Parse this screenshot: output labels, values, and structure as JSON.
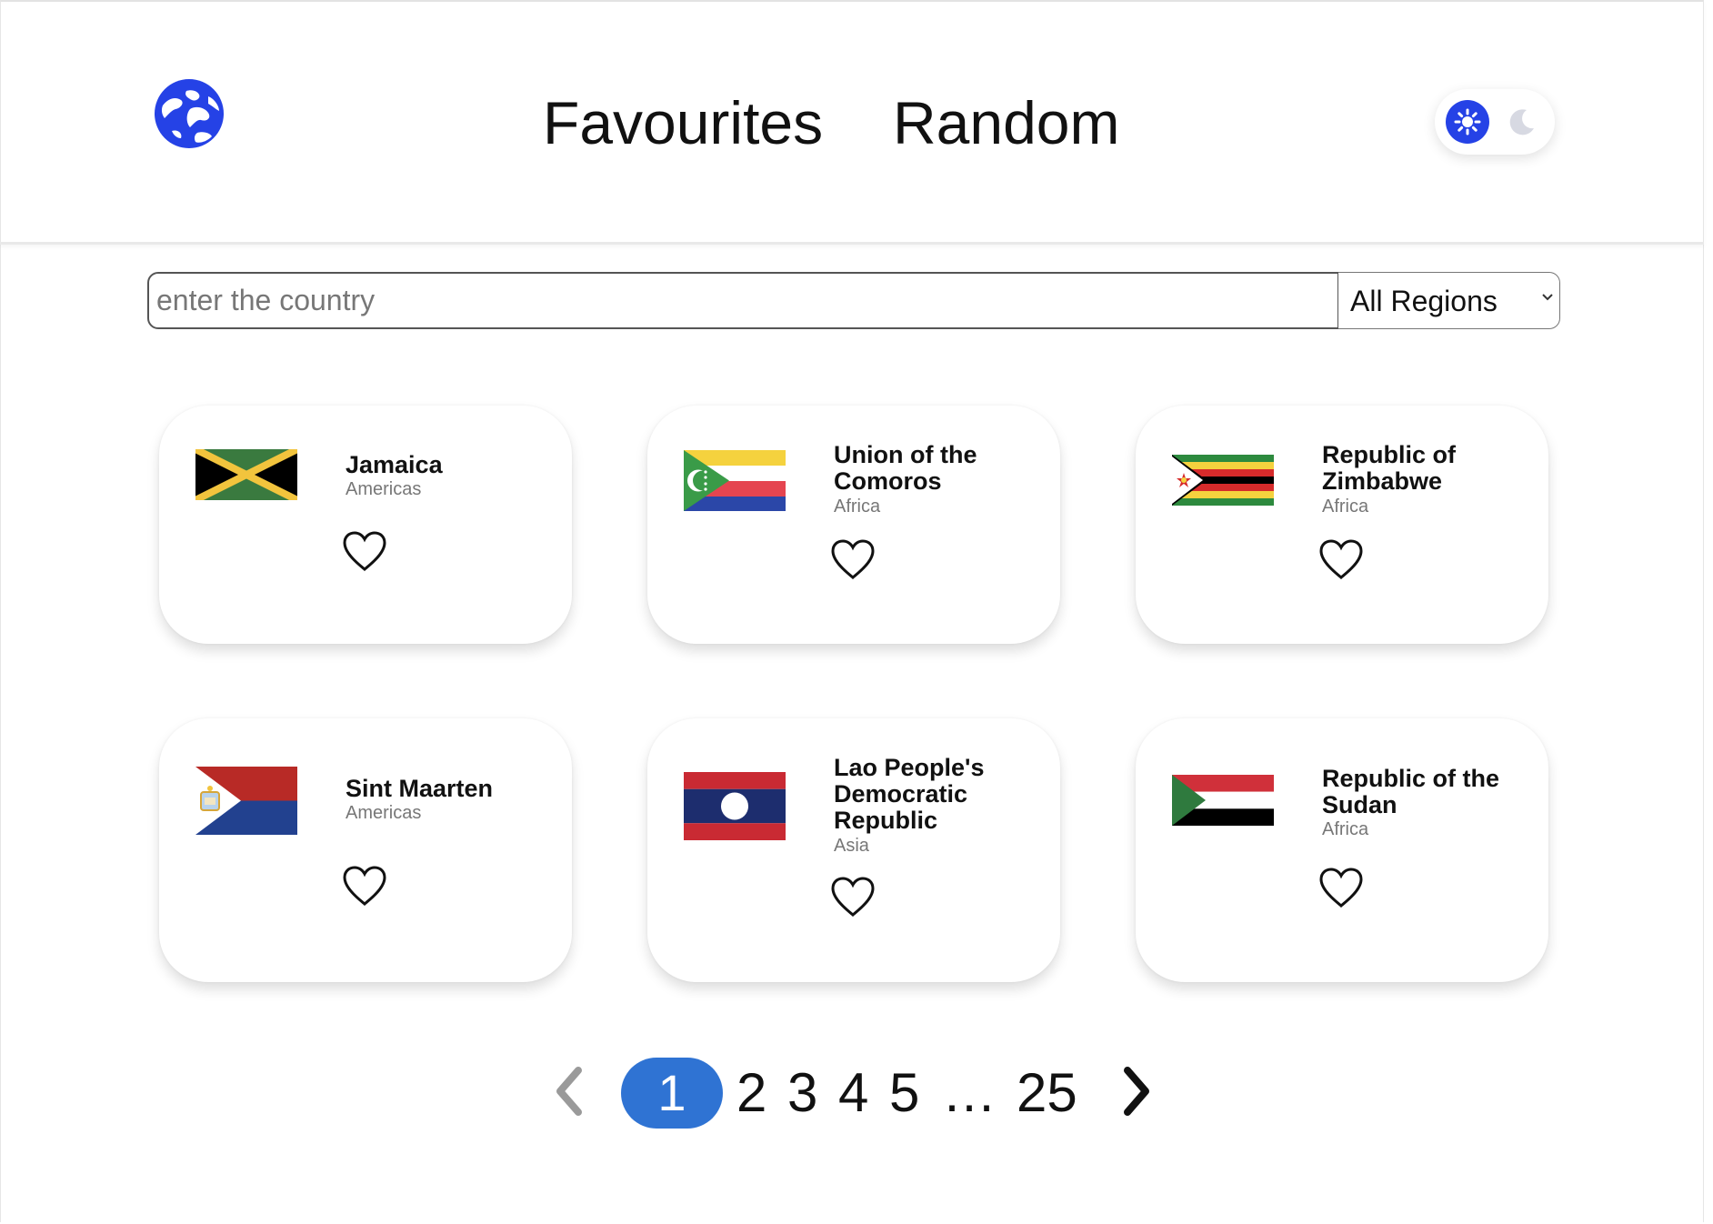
{
  "nav": {
    "favourites": "Favourites",
    "random": "Random"
  },
  "theme": {
    "active": "light",
    "accent": "#2542e6"
  },
  "search": {
    "placeholder": "enter the country",
    "value": ""
  },
  "region_filter": {
    "selected": "All Regions"
  },
  "countries": [
    {
      "name": "Jamaica",
      "region": "Americas",
      "flag_icon": "jamaica-flag-icon",
      "favourite": false
    },
    {
      "name": "Union of the Comoros",
      "region": "Africa",
      "flag_icon": "comoros-flag-icon",
      "favourite": false
    },
    {
      "name": "Republic of Zimbabwe",
      "region": "Africa",
      "flag_icon": "zimbabwe-flag-icon",
      "favourite": false
    },
    {
      "name": "Sint Maarten",
      "region": "Americas",
      "flag_icon": "sint-maarten-flag-icon",
      "favourite": false
    },
    {
      "name": "Lao People's Democratic Republic",
      "region": "Asia",
      "flag_icon": "laos-flag-icon",
      "favourite": false
    },
    {
      "name": "Republic of the Sudan",
      "region": "Africa",
      "flag_icon": "sudan-flag-icon",
      "favourite": false
    }
  ],
  "pagination": {
    "current": "1",
    "pages": [
      "2",
      "3",
      "4",
      "5"
    ],
    "ellipsis": "…",
    "last": "25",
    "active_color": "#2f73d3"
  }
}
